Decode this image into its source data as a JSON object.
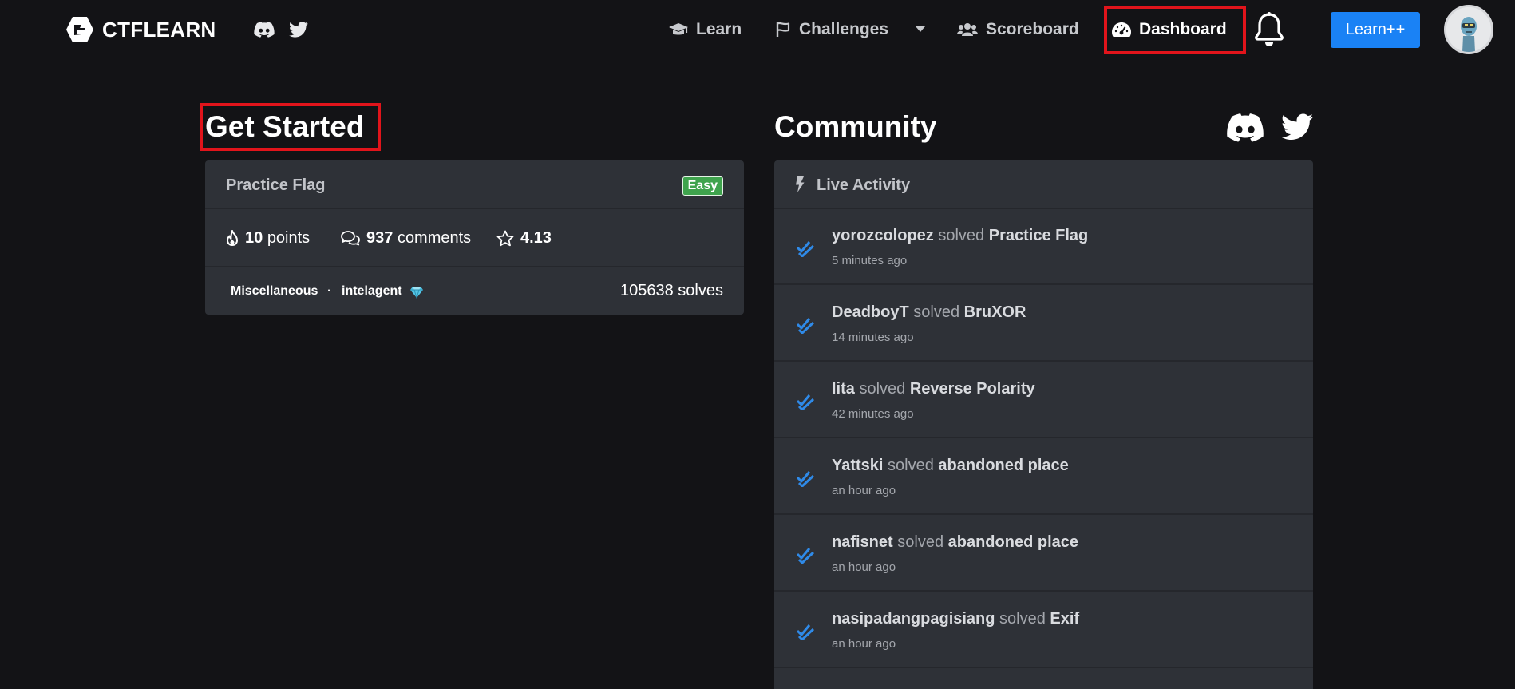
{
  "navbar": {
    "brand": "CTFLEARN",
    "links": {
      "learn": "Learn",
      "challenges": "Challenges",
      "scoreboard": "Scoreboard",
      "dashboard": "Dashboard"
    },
    "learnpp": "Learn++"
  },
  "get_started": {
    "title": "Get Started",
    "card": {
      "name": "Practice Flag",
      "difficulty": "Easy",
      "points_value": "10",
      "points_label": "points",
      "comments_value": "937",
      "comments_label": "comments",
      "rating": "4.13",
      "category": "Miscellaneous",
      "separator": "·",
      "author": "intelagent",
      "solves": "105638 solves"
    }
  },
  "community": {
    "title": "Community",
    "live_activity_label": "Live Activity",
    "items": [
      {
        "user": "yorozcolopez",
        "verb": "solved",
        "challenge": "Practice Flag",
        "time": "5 minutes ago"
      },
      {
        "user": "DeadboyT",
        "verb": "solved",
        "challenge": "BruXOR",
        "time": "14 minutes ago"
      },
      {
        "user": "lita",
        "verb": "solved",
        "challenge": "Reverse Polarity",
        "time": "42 minutes ago"
      },
      {
        "user": "Yattski",
        "verb": "solved",
        "challenge": "abandoned place",
        "time": "an hour ago"
      },
      {
        "user": "nafisnet",
        "verb": "solved",
        "challenge": "abandoned place",
        "time": "an hour ago"
      },
      {
        "user": "nasipadangpagisiang",
        "verb": "solved",
        "challenge": "Exif",
        "time": "an hour ago"
      }
    ]
  },
  "icons": {
    "logo": "ctflearn-logo-icon",
    "discord": "discord-icon",
    "twitter": "twitter-icon",
    "learn": "graduation-cap-icon",
    "challenges": "flag-icon",
    "challenges_dropdown": "caret-down-icon",
    "scoreboard": "users-icon",
    "dashboard": "tachometer-icon",
    "notifications": "bell-icon",
    "points": "fire-icon",
    "comments": "comments-icon",
    "rating": "star-icon",
    "author_badge": "gem-icon",
    "activity": "bolt-icon",
    "solved": "double-check-icon"
  },
  "colors": {
    "background": "#131316",
    "card": "#2e3137",
    "accent_blue": "#1a82f5",
    "easy_badge": "#3fa34d",
    "highlight": "#e1141b"
  }
}
